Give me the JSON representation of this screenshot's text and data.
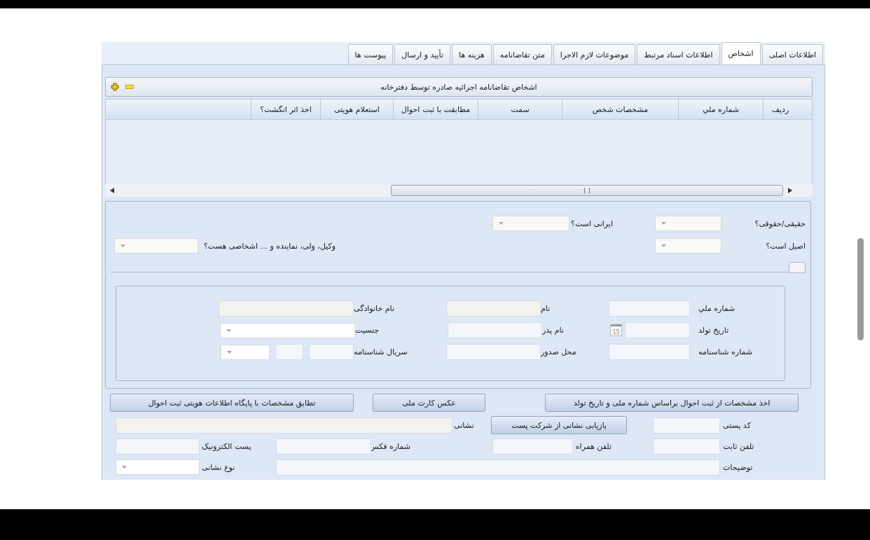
{
  "tabs": [
    {
      "label": "اطلاعات اصلی",
      "selected": false
    },
    {
      "label": "اشخاص",
      "selected": true
    },
    {
      "label": "اطلاعات اسناد مرتبط",
      "selected": false
    },
    {
      "label": "موضوعات لازم الاجرا",
      "selected": false
    },
    {
      "label": "متن تقاضانامه",
      "selected": false
    },
    {
      "label": "هزینه ها",
      "selected": false
    },
    {
      "label": "تأیید و ارسال",
      "selected": false
    },
    {
      "label": "پیوست ها",
      "selected": false
    }
  ],
  "grid": {
    "title": "اشخاص تقاضانامه اجرائیه صادره توسط دفترخانه",
    "columns": [
      "ردیف",
      "شماره ملي",
      "مشخصات شخص",
      "سمت",
      "مطابقت با ثبت احوال",
      "استعلام هویتی",
      "اخذ اثر انگشت؟"
    ]
  },
  "form_expanded": true,
  "questions": {
    "legal_type": "حقیقی/حقوقی؟",
    "iranian": "ایرانی است؟",
    "principal": "اصیل است؟",
    "representative": "وکیل، ولی، نماینده و ... اشخاصی هست؟"
  },
  "identity": {
    "national_id": "شماره ملي",
    "first_name": "نام",
    "last_name": "نام خانوادگی",
    "birth_date": "تاریخ تولد",
    "calendar_day": "15",
    "father_name": "نام پدر",
    "gender": "جنسیت",
    "certificate_number": "شماره شناسنامه",
    "issue_place": "محل صدور",
    "certificate_serial": "سریال شناسنامه"
  },
  "actions": [
    "اخذ مشخصات از ثبت احوال براساس شماره ملی و تاریخ تولد",
    "عکس کارت ملی",
    "تطابق مشخصات با پایگاه اطلاعات هویتی ثبت احوال"
  ],
  "address": {
    "postal_code": "کد پستی",
    "lookup_button": "بازیابی نشانی از شرکت پست",
    "address": "نشانی",
    "phone": "تلفن ثابت",
    "mobile": "تلفن همراه",
    "fax": "شماره فکس",
    "email": "پست الکترونیک",
    "notes": "توضیحات",
    "address_type": "نوع نشانی"
  }
}
